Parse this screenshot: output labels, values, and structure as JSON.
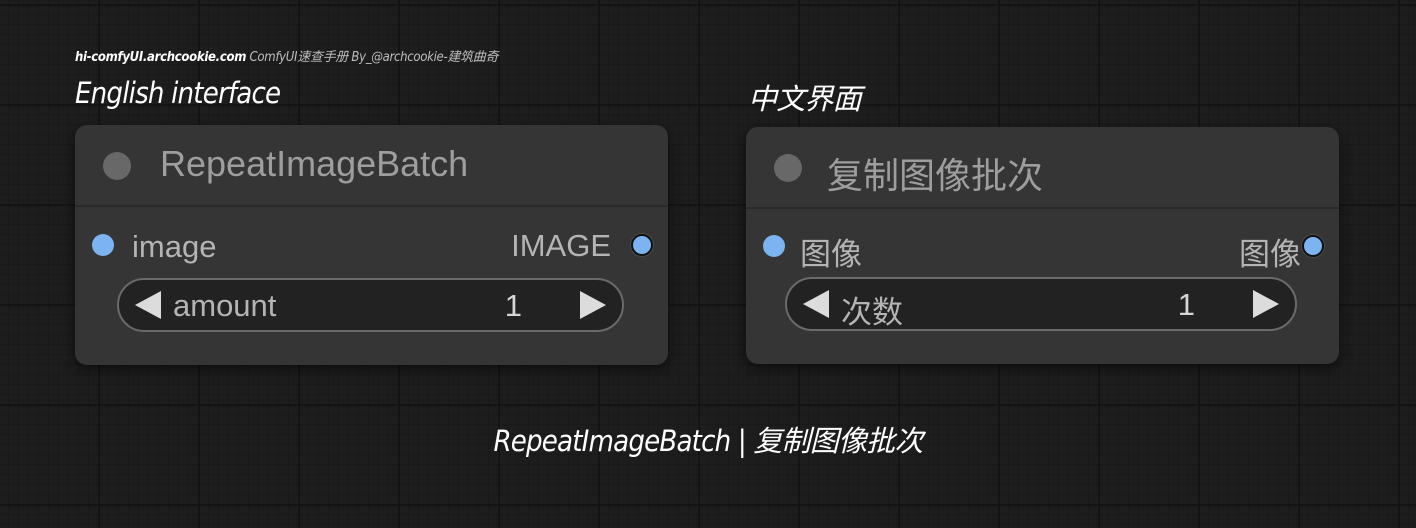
{
  "credit": {
    "site": "hi-comfyUI.archcookie.com",
    "rest": "ComfyUI速查手册 By_@archcookie-建筑曲奇"
  },
  "headings": {
    "english": "English interface",
    "chinese": "中文界面"
  },
  "caption": "RepeatImageBatch | 复制图像批次",
  "nodes": {
    "english": {
      "title": "RepeatImageBatch",
      "input_label": "image",
      "output_label": "IMAGE",
      "widget_label": "amount",
      "widget_value": "1"
    },
    "chinese": {
      "title": "复制图像批次",
      "input_label": "图像",
      "output_label": "图像",
      "widget_label": "次数",
      "widget_value": "1"
    }
  },
  "colors": {
    "slot": "#7cb4f2",
    "node_bg": "#353535",
    "canvas_bg": "#1d1d1d"
  }
}
